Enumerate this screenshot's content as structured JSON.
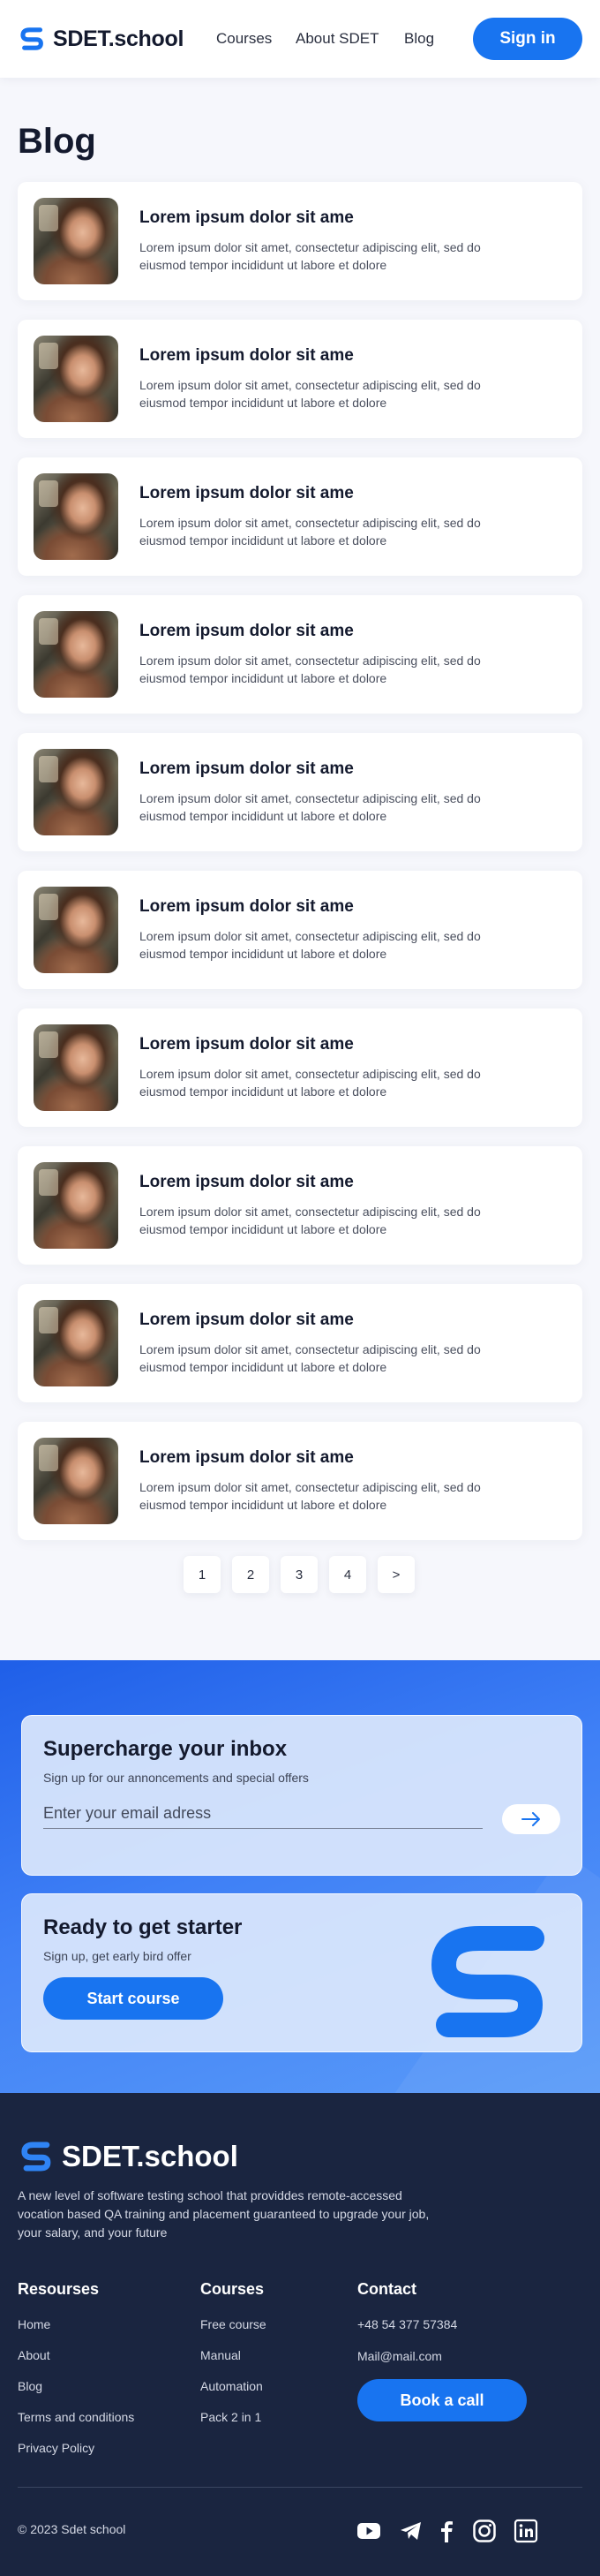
{
  "header": {
    "logo_text": "SDET.school",
    "nav": [
      "Courses",
      "About SDET",
      "Blog"
    ],
    "signin_label": "Sign in"
  },
  "page_title": "Blog",
  "posts": [
    {
      "title": "Lorem ipsum dolor sit ame",
      "excerpt": "Lorem ipsum dolor sit amet, consectetur adipiscing elit, sed do eiusmod tempor incididunt ut labore et dolore"
    },
    {
      "title": "Lorem ipsum dolor sit ame",
      "excerpt": "Lorem ipsum dolor sit amet, consectetur adipiscing elit, sed do eiusmod tempor incididunt ut labore et dolore"
    },
    {
      "title": "Lorem ipsum dolor sit ame",
      "excerpt": "Lorem ipsum dolor sit amet, consectetur adipiscing elit, sed do eiusmod tempor incididunt ut labore et dolore"
    },
    {
      "title": "Lorem ipsum dolor sit ame",
      "excerpt": "Lorem ipsum dolor sit amet, consectetur adipiscing elit, sed do eiusmod tempor incididunt ut labore et dolore"
    },
    {
      "title": "Lorem ipsum dolor sit ame",
      "excerpt": "Lorem ipsum dolor sit amet, consectetur adipiscing elit, sed do eiusmod tempor incididunt ut labore et dolore"
    },
    {
      "title": "Lorem ipsum dolor sit ame",
      "excerpt": "Lorem ipsum dolor sit amet, consectetur adipiscing elit, sed do eiusmod tempor incididunt ut labore et dolore"
    },
    {
      "title": "Lorem ipsum dolor sit ame",
      "excerpt": "Lorem ipsum dolor sit amet, consectetur adipiscing elit, sed do eiusmod tempor incididunt ut labore et dolore"
    },
    {
      "title": "Lorem ipsum dolor sit ame",
      "excerpt": "Lorem ipsum dolor sit amet, consectetur adipiscing elit, sed do eiusmod tempor incididunt ut labore et dolore"
    },
    {
      "title": "Lorem ipsum dolor sit ame",
      "excerpt": "Lorem ipsum dolor sit amet, consectetur adipiscing elit, sed do eiusmod tempor incididunt ut labore et dolore"
    },
    {
      "title": "Lorem ipsum dolor sit ame",
      "excerpt": "Lorem ipsum dolor sit amet, consectetur adipiscing elit, sed do eiusmod tempor incididunt ut labore et dolore"
    }
  ],
  "pagination": [
    "1",
    "2",
    "3",
    "4",
    ">"
  ],
  "newsletter": {
    "title": "Supercharge your inbox",
    "subtitle": "Sign up for our annoncements and special offers",
    "placeholder": "Enter your email adress",
    "submit_icon": "arrow-right-icon"
  },
  "starter": {
    "title": "Ready to get starter",
    "subtitle": "Sign up, get early bird offer",
    "button_label": "Start course"
  },
  "footer": {
    "logo_text": "SDET.school",
    "description": "A new level of software testing school that providdes remote-accessed vocation based QA training and placement guaranteed to upgrade your job, your salary, and your future",
    "resources": {
      "title": "Resourses",
      "links": [
        "Home",
        "About",
        "Blog",
        "Terms and conditions",
        "Privacy Policy"
      ]
    },
    "courses": {
      "title": "Courses",
      "links": [
        "Free course",
        "Manual",
        "Automation",
        "Pack 2 in 1"
      ]
    },
    "contact": {
      "title": "Contact",
      "phone": "+48 54 377 57384",
      "email": "Mail@mail.com",
      "button_label": "Book a call"
    },
    "copyright": "© 2023 Sdet school",
    "social": [
      "youtube-icon",
      "telegram-icon",
      "facebook-icon",
      "instagram-icon",
      "linkedin-icon"
    ]
  },
  "colors": {
    "accent": "#1874f0",
    "footer_bg": "#1a2540",
    "page_bg": "#f6f7fc"
  }
}
